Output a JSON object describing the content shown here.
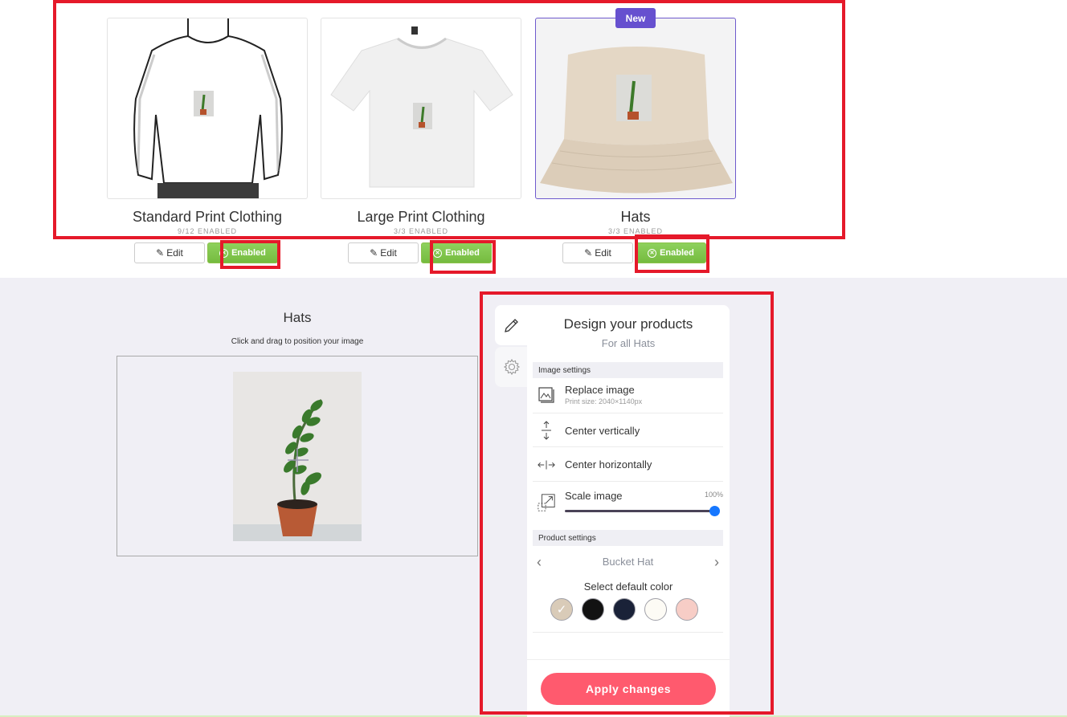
{
  "products": [
    {
      "title": "Standard Print Clothing",
      "count": "9/12 ENABLED",
      "edit_label": "Edit",
      "status_label": "Enabled",
      "badge": null
    },
    {
      "title": "Large Print Clothing",
      "count": "3/3 ENABLED",
      "edit_label": "Edit",
      "status_label": "Enabled",
      "badge": null
    },
    {
      "title": "Hats",
      "count": "3/3 ENABLED",
      "edit_label": "Edit",
      "status_label": "Enabled",
      "badge": "New"
    }
  ],
  "preview": {
    "title": "Hats",
    "hint": "Click and drag to position your image"
  },
  "panel": {
    "title": "Design your products",
    "subtitle": "For all Hats",
    "image_settings_label": "Image settings",
    "replace_image_label": "Replace image",
    "print_size": "Print size: 2040×1140px",
    "center_vertically_label": "Center vertically",
    "center_horizontally_label": "Center horizontally",
    "scale_image_label": "Scale image",
    "scale_value": "100%",
    "scale_fraction": 1.0,
    "product_settings_label": "Product settings",
    "product_name": "Bucket Hat",
    "select_color_label": "Select default color",
    "colors": [
      {
        "name": "beige",
        "hex": "#d9cbb8",
        "selected": true
      },
      {
        "name": "black",
        "hex": "#121212",
        "selected": false
      },
      {
        "name": "navy",
        "hex": "#1a2238",
        "selected": false
      },
      {
        "name": "white",
        "hex": "#fdfbf5",
        "selected": false
      },
      {
        "name": "pink",
        "hex": "#f7cdc6",
        "selected": false
      }
    ],
    "apply_label": "Apply changes"
  },
  "colors": {
    "accent_purple": "#6650cf",
    "enabled_green": "#7cc24a",
    "apply_red": "#ff5a6e",
    "slider_blue": "#1677ff",
    "annotation_red": "#e5192a"
  }
}
